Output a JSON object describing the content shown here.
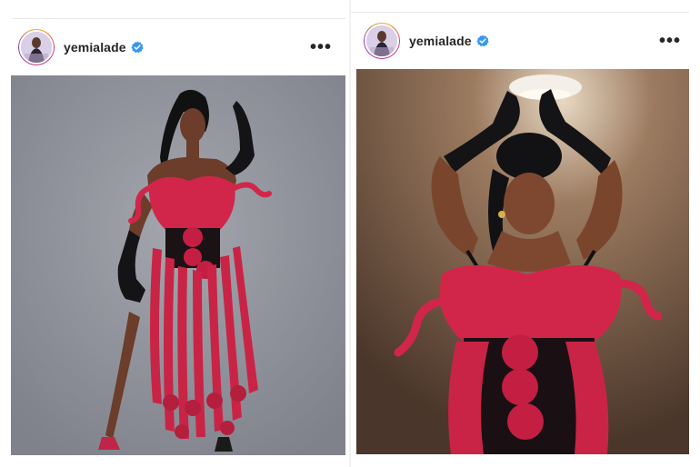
{
  "posts": [
    {
      "username": "yemialade",
      "verified": true,
      "more_label": "•••",
      "photo_alt": "",
      "colors": {
        "backdrop": "#9597a0",
        "dress": "#d1264a",
        "gloves": "#141416"
      }
    },
    {
      "username": "yemialade",
      "verified": true,
      "more_label": "•••",
      "photo_alt": "",
      "colors": {
        "backdrop": "#6b5140",
        "dress": "#d1264a",
        "gloves": "#141416"
      }
    }
  ],
  "icons": {
    "verified": "verified-badge-icon",
    "more": "more-options-icon"
  },
  "colors": {
    "verified_blue": "#3897f0",
    "text": "#262626"
  }
}
